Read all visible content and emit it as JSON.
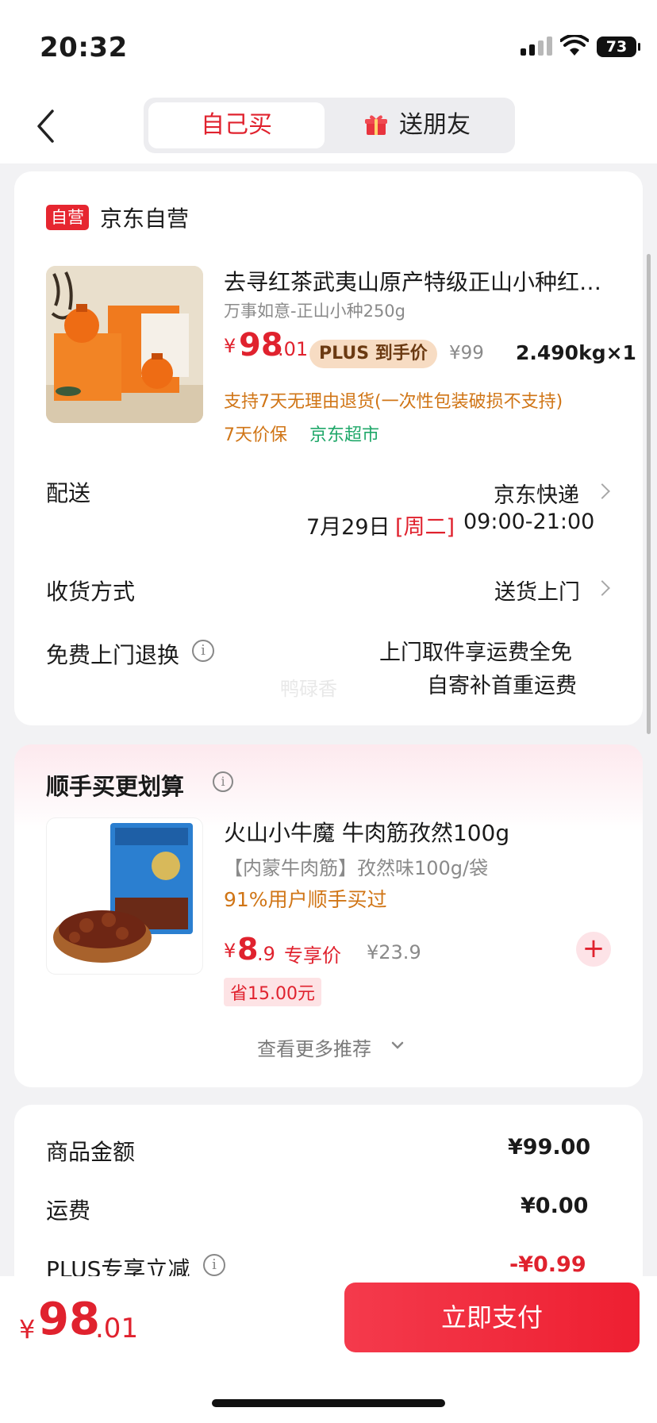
{
  "status": {
    "time": "20:32",
    "battery": "73"
  },
  "tabs": {
    "self": "自己买",
    "gift": "送朋友"
  },
  "store": {
    "badge": "自营",
    "name": "京东自营"
  },
  "product": {
    "title": "去寻红茶武夷山原产特级正山小种红…",
    "spec": "万事如意-正山小种250g",
    "price_int": "98",
    "price_dec": ".01",
    "currency": "¥",
    "plus_label": "PLUS 到手价",
    "orig_price": "¥99",
    "weight_qty": "2.490kg×1",
    "return_policy": "支持7天无理由退货(一次性包装破损不支持)",
    "price_protect": "7天价保",
    "market": "京东超市"
  },
  "delivery": {
    "label": "配送",
    "carrier": "京东快递",
    "date": "7月29日",
    "weekday": "[周二]",
    "time": "09:00-21:00"
  },
  "receive": {
    "label": "收货方式",
    "value": "送货上门"
  },
  "free_return": {
    "label": "免费上门退换",
    "line1": "上门取件享运费全免",
    "line2": "自寄补首重运费",
    "watermark": "鸭碌香"
  },
  "recommend": {
    "title": "顺手买更划算",
    "item_title": "火山小牛魔 牛肉筋孜然100g",
    "item_spec": "【内蒙牛肉筋】孜然味100g/袋",
    "item_social": "91%用户顺手买过",
    "price_int": "8",
    "price_dec": ".9",
    "price_label": "专享价",
    "orig_price": "¥23.9",
    "save": "省15.00元",
    "more": "查看更多推荐"
  },
  "summary": {
    "goods_label": "商品金额",
    "goods_value": "¥99.00",
    "ship_label": "运费",
    "ship_value": "¥0.00",
    "plus_label": "PLUS专享立减",
    "plus_value": "-¥0.99"
  },
  "footer": {
    "price_int": "98",
    "price_dec": ".01",
    "pay": "立即支付"
  }
}
